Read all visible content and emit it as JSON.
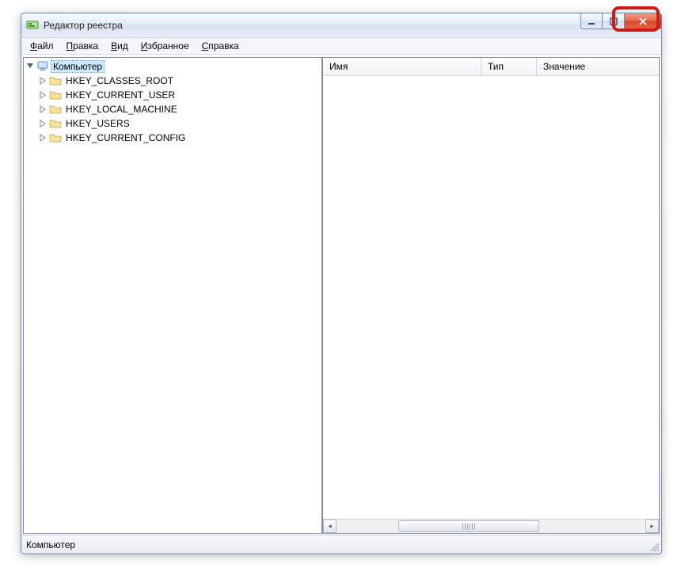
{
  "window": {
    "title": "Редактор реестра"
  },
  "menu": {
    "file": {
      "hot": "Ф",
      "rest": "айл"
    },
    "edit": {
      "hot": "П",
      "rest": "равка"
    },
    "view": {
      "hot": "В",
      "rest": "ид"
    },
    "favorites": {
      "hot": "И",
      "rest": "збранное"
    },
    "help": {
      "hot": "С",
      "rest": "правка"
    }
  },
  "tree": {
    "root_label": "Компьютер",
    "hives": [
      "HKEY_CLASSES_ROOT",
      "HKEY_CURRENT_USER",
      "HKEY_LOCAL_MACHINE",
      "HKEY_USERS",
      "HKEY_CURRENT_CONFIG"
    ]
  },
  "list": {
    "col_name": "Имя",
    "col_type": "Тип",
    "col_value": "Значение"
  },
  "status": {
    "path": "Компьютер"
  },
  "highlight": {
    "target": "close-button"
  }
}
